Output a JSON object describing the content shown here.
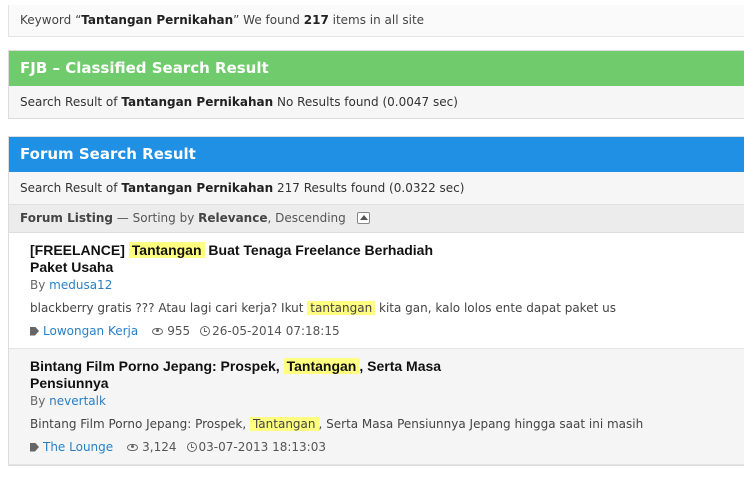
{
  "keyword_bar": {
    "prefix": "Keyword “",
    "keyword": "Tantangan Pernikahan",
    "middle": "” We found ",
    "count": "217",
    "suffix": " items in all site"
  },
  "fjb": {
    "title": "FJB – Classified Search Result",
    "summary_prefix": "Search Result of ",
    "keyword": "Tantangan Pernikahan",
    "summary_suffix": "  No Results found (0.0047 sec)",
    "color": "#6fcb6b"
  },
  "forum": {
    "title": "Forum Search Result",
    "summary_prefix": "Search Result of ",
    "keyword": "Tantangan Pernikahan",
    "summary_suffix": " 217 Results found (0.0322 sec)",
    "color": "#1f90e3",
    "sort": {
      "label": "Forum Listing",
      "middle": " — Sorting by ",
      "field": "Relevance",
      "order": ", Descending"
    },
    "results": [
      {
        "title_before": "[FREELANCE] ",
        "title_hl": "Tantangan",
        "title_after": " Buat Tenaga Freelance Berhadiah Paket Usaha",
        "by": "By ",
        "author": "medusa12",
        "snippet_before": "blackberry gratis ??? Atau lagi cari kerja? Ikut ",
        "snippet_hl": "tantangan",
        "snippet_after": " kita gan, kalo lolos ente dapat paket us",
        "category": "Lowongan Kerja",
        "views": "955",
        "date": "26-05-2014 07:18:15"
      },
      {
        "title_before": "Bintang Film Porno Jepang: Prospek, ",
        "title_hl": "Tantangan",
        "title_after": ", Serta Masa Pensiunnya",
        "by": "By ",
        "author": "nevertalk",
        "snippet_before": "Bintang Film Porno Jepang: Prospek, ",
        "snippet_hl": "Tantangan",
        "snippet_after": ", Serta Masa Pensiunnya Jepang hingga saat ini masih",
        "category": "The Lounge",
        "views": "3,124",
        "date": "03-07-2013 18:13:03"
      }
    ]
  },
  "icons": {
    "tag": "tag-icon",
    "views": "eye-icon",
    "date": "clock-icon",
    "sort_toggle": "chevron-up-icon"
  }
}
